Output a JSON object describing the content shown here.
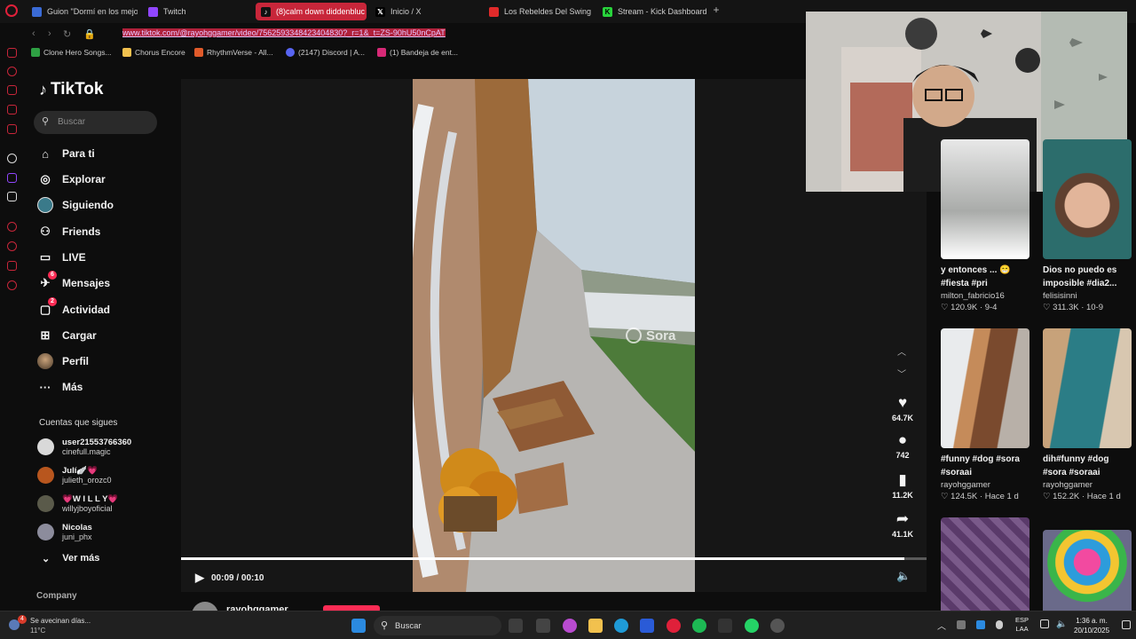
{
  "browser": {
    "tabs": [
      {
        "label": "Guion \"Dormí en los mejo",
        "fav_color": "#3a6bd6",
        "active": false
      },
      {
        "label": "Twitch",
        "fav_color": "#9146ff",
        "active": false
      },
      {
        "label": "(8)calm down diddenbluc",
        "fav_color": "#111111",
        "active": true
      },
      {
        "label": "Inicio / X",
        "fav_color": "#000000",
        "active": false
      },
      {
        "label": "Los Rebeldes Del Swing",
        "fav_color": "#e02a2a",
        "active": false
      },
      {
        "label": "Stream - Kick Dashboard",
        "fav_color": "#28d33b",
        "active": false
      }
    ],
    "new_tab": "+",
    "url": "www.tiktok.com/@rayohggamer/video/7562593348423404830?_r=1&_t=ZS-90hU50nCpAT",
    "bookmarks": [
      {
        "label": "Clone Hero Songs...",
        "fav_color": "#2ea043"
      },
      {
        "label": "Chorus Encore",
        "fav_color": "#f2c14e"
      },
      {
        "label": "RhythmVerse - All...",
        "fav_color": "#e05a2a"
      },
      {
        "label": "(2147) Discord | A...",
        "fav_color": "#5865f2"
      },
      {
        "label": "(1) Bandeja de ent...",
        "fav_color": "#d62976"
      }
    ]
  },
  "tiktok": {
    "logo": "TikTok",
    "search_placeholder": "Buscar",
    "nav": [
      {
        "label": "Para ti",
        "icon": "home-icon",
        "glyph": "⌂"
      },
      {
        "label": "Explorar",
        "icon": "compass-icon",
        "glyph": "◎"
      },
      {
        "label": "Siguiendo",
        "icon": "following-avatar-icon",
        "glyph": "●"
      },
      {
        "label": "Friends",
        "icon": "friends-icon",
        "glyph": "⚇"
      },
      {
        "label": "LIVE",
        "icon": "live-icon",
        "glyph": "▭"
      },
      {
        "label": "Mensajes",
        "icon": "messages-icon",
        "glyph": "✈",
        "badge": "6"
      },
      {
        "label": "Actividad",
        "icon": "activity-icon",
        "glyph": "▢",
        "badge": "2"
      },
      {
        "label": "Cargar",
        "icon": "upload-icon",
        "glyph": "⊞"
      },
      {
        "label": "Perfil",
        "icon": "profile-avatar-icon",
        "glyph": "●"
      },
      {
        "label": "Más",
        "icon": "more-icon",
        "glyph": "···"
      }
    ],
    "following_title": "Cuentas que sigues",
    "following": [
      {
        "name": "user21553766360",
        "handle": "cinefull.magic",
        "color": "#d9d9d9"
      },
      {
        "name": "Julí🪽💗",
        "handle": "julieth_orozc0",
        "color": "#b8561e"
      },
      {
        "name": "💗W I L L Y💗",
        "handle": "willyjboyoficial",
        "color": "#5a5a4a"
      },
      {
        "name": "Nicolas",
        "handle": "juni_phx",
        "color": "#8c8c9c"
      }
    ],
    "see_more": "Ver más",
    "company": "Company"
  },
  "player": {
    "watermark": "Sora",
    "time": "00:09 / 00:10",
    "progress": 0.97,
    "likes": "64.7K",
    "comments": "742",
    "saves": "11.2K",
    "shares": "41.1K"
  },
  "recommended": [
    {
      "title1": "y entonces ... 😁",
      "title2": "#fiesta #pri",
      "user": "milton_fabricio16",
      "views": "120.9K",
      "date": "9-4"
    },
    {
      "title1": "Dios no puedo es",
      "title2": "imposible #dia2...",
      "user": "felisisinni",
      "views": "311.3K",
      "date": "10-9"
    },
    {
      "title1": "#funny #dog #sora",
      "title2": "#soraai",
      "user": "rayohggamer",
      "views": "124.5K",
      "date": "Hace 1 d"
    },
    {
      "title1": "dih#funny #dog",
      "title2": "#sora #soraai",
      "user": "rayohggamer",
      "views": "152.2K",
      "date": "Hace 1 d"
    }
  ],
  "bottom_username": "rayohggamer",
  "taskbar": {
    "weather_text": "Se avecinan días...",
    "weather_temp": "11°C",
    "weather_badge": "4",
    "search": "Buscar",
    "lang1": "ESP",
    "lang2": "LAA",
    "time": "1:36 a. m.",
    "date": "20/10/2025"
  }
}
